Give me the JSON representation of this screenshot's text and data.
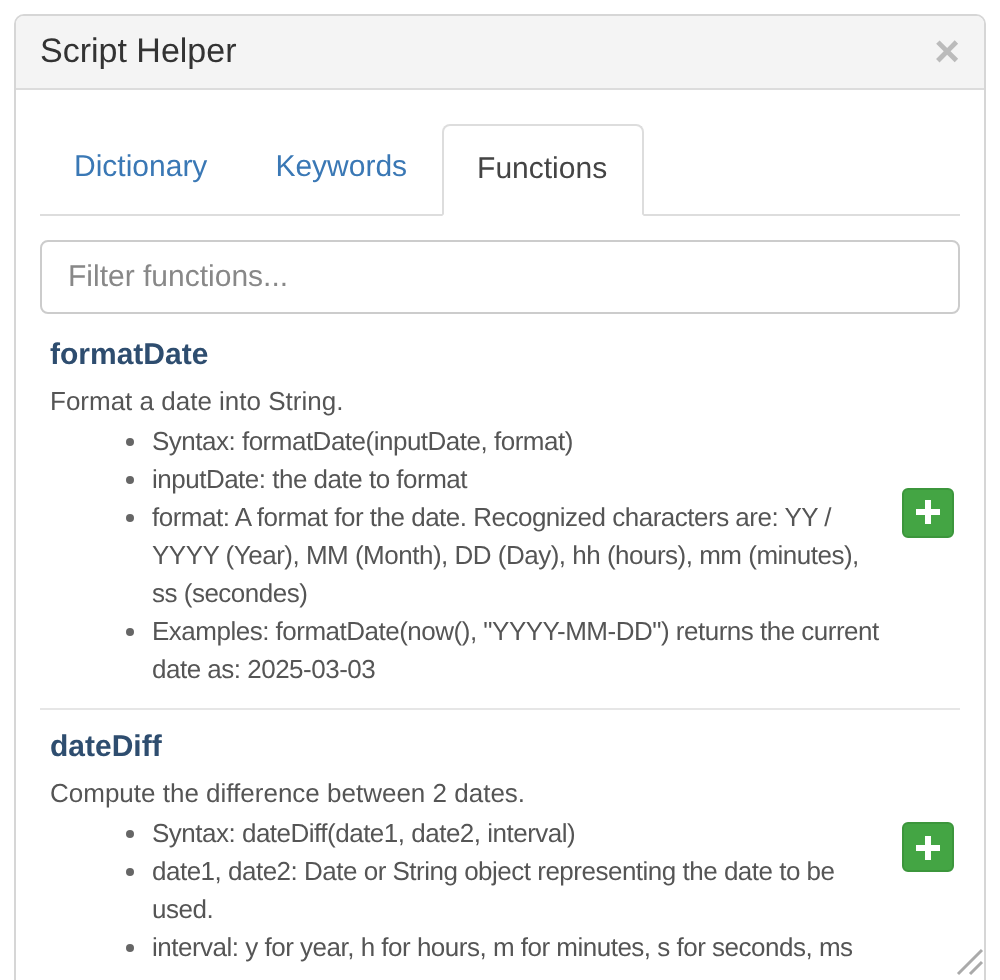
{
  "dialog": {
    "title": "Script Helper",
    "close": "×"
  },
  "tabs": [
    {
      "label": "Dictionary",
      "selected": false
    },
    {
      "label": "Keywords",
      "selected": false
    },
    {
      "label": "Functions",
      "selected": true
    }
  ],
  "filter": {
    "placeholder": "Filter functions..."
  },
  "functions": [
    {
      "name": "formatDate",
      "description": "Format a date into String.",
      "details": [
        "Syntax: formatDate(inputDate, format)",
        "inputDate: the date to format",
        "format: A format for the date. Recognized characters are: YY / YYYY (Year), MM (Month), DD (Day), hh (hours), mm (minutes), ss (secondes)",
        "Examples: formatDate(now(), \"YYYY-MM-DD\") returns the current date as: 2025-03-03"
      ]
    },
    {
      "name": "dateDiff",
      "description": "Compute the difference between 2 dates.",
      "details": [
        "Syntax: dateDiff(date1, date2, interval)",
        "date1, date2: Date or String object representing the date to be used.",
        "interval: y for year, h for hours, m for minutes, s for seconds, ms"
      ]
    }
  ]
}
